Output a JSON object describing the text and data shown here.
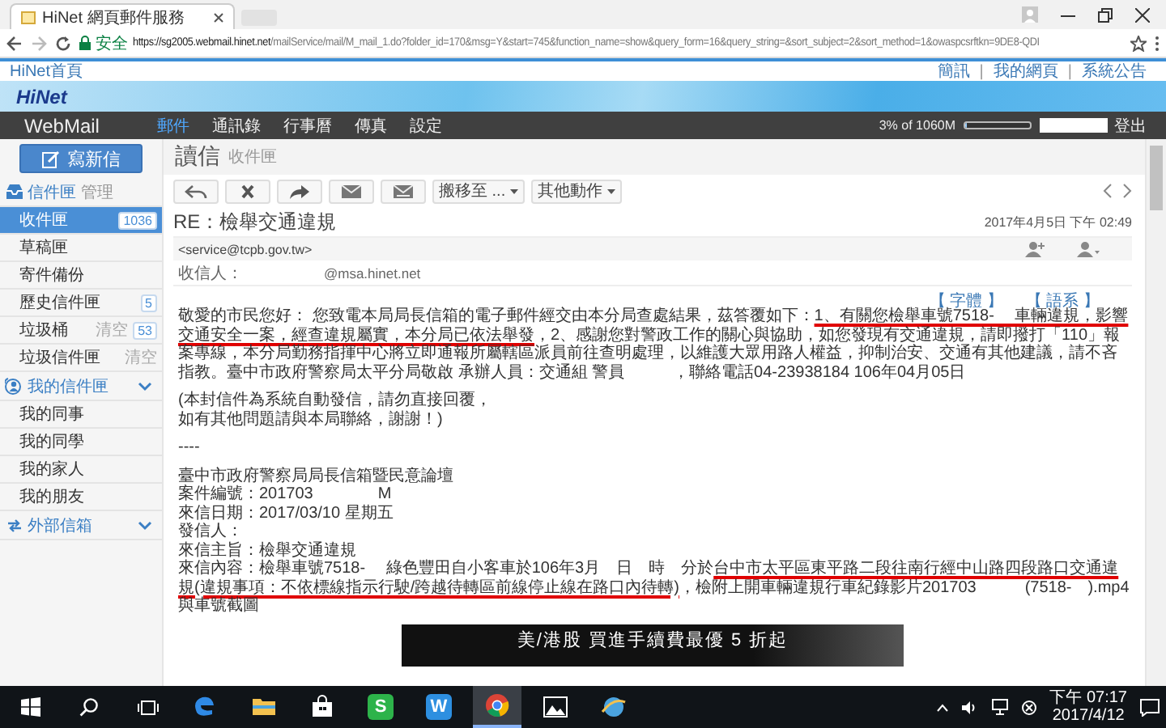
{
  "browser": {
    "tab_title": "HiNet 網頁郵件服務",
    "security_label": "安全",
    "url_host": "https://sg2005.webmail.hinet.net",
    "url_path": "/mailService/mail/M_mail_1.do?folder_id=170&msg=Y&start=745&function_name=show&query_form=16&query_string=&sort_subject=2&sort_method=1&owaspcsrftkn=9DE8-QDI"
  },
  "site_links": {
    "home": "HiNet首頁",
    "links": [
      {
        "kind": "link",
        "label": "簡訊"
      },
      {
        "kind": "separator",
        "label": "|"
      },
      {
        "kind": "link",
        "label": "我的網頁"
      },
      {
        "kind": "separator",
        "label": "|"
      },
      {
        "kind": "link",
        "label": "系統公告"
      }
    ]
  },
  "banner": {
    "logo": "HiNet"
  },
  "nav": {
    "brand": "WebMail",
    "items": [
      {
        "label": "郵件",
        "selected": true
      },
      {
        "label": "通訊錄",
        "selected": false
      },
      {
        "label": "行事曆",
        "selected": false
      },
      {
        "label": "傳真",
        "selected": false
      },
      {
        "label": "設定",
        "selected": false
      }
    ],
    "quota": {
      "text": "3% of 1060M",
      "level": 0.03
    },
    "logout": "登出"
  },
  "compose_button": "寫新信",
  "sidebar": {
    "sections": [
      {
        "title": "信件匣",
        "action": "管理",
        "collapsible": false,
        "items": [
          {
            "label": "收件匣",
            "badge": "1036",
            "selected": true
          },
          {
            "label": "草稿匣",
            "selected": false
          },
          {
            "label": "寄件備份",
            "selected": false
          },
          {
            "label": "歷史信件匣",
            "badge": "5",
            "selected": false
          },
          {
            "label": "垃圾桶",
            "action": "清空",
            "badge": "53",
            "selected": false
          },
          {
            "label": "垃圾信件匣",
            "action": "清空",
            "selected": false
          }
        ]
      },
      {
        "title": "我的信件匣",
        "collapsible": true,
        "items": [
          {
            "label": "我的同事",
            "selected": false
          },
          {
            "label": "我的同學",
            "selected": false
          },
          {
            "label": "我的家人",
            "selected": false
          },
          {
            "label": "我的朋友",
            "selected": false
          }
        ]
      },
      {
        "title": "外部信箱",
        "collapsible": true
      }
    ]
  },
  "page_header": {
    "title": "讀信",
    "subtitle": "收件匣"
  },
  "toolbar": {
    "move": "搬移至 ...",
    "more": "其他動作"
  },
  "message": {
    "subject": "RE：檢舉交通違規",
    "date": "2017年4月5日 下午 02:49",
    "from": "<service@tcpb.gov.tw>",
    "to_label": "收信人：",
    "to": "@msa.hinet.net",
    "options": [
      "【 字體 】",
      "【 語系 】"
    ],
    "body": [
      [
        {
          "text": "敬愛的市民您好： 您致電本局局長信箱的電子郵件經交由本分局查處結果，茲答覆如下：",
          "underlined": false
        },
        {
          "text": "1、有關您檢舉車號7518-　 車輛違規，影響交通安全一案，經查違規屬實，本分局已依法舉發",
          "underlined": true
        },
        {
          "text": "，2、感謝您對警政工作的關心與協助，如您發現有交通違規，請即撥打「110」報案專線，本分局勤務指揮中心將立即通報所屬轄區派員前往查明處理，以維護大眾用路人權益，抑制治安、交通有其他建議，請不吝指教。臺中市政府警察局太平分局敬啟 承辦人員：交通組 警員　　　，聯絡電話04-23938184 106年04月05日",
          "underlined": false
        }
      ],
      [
        {
          "text": "(本封信件為系統自動發信，請勿直接回覆，",
          "underlined": false
        }
      ],
      [
        {
          "text": "如有其他問題請與本局聯絡，謝謝！)",
          "underlined": false
        }
      ],
      [
        {
          "text": "----",
          "underlined": false
        }
      ],
      [
        {
          "text": "臺中市政府警察局局長信箱暨民意論壇",
          "underlined": false
        }
      ],
      [
        {
          "text": "案件編號：201703　　　　M",
          "underlined": false
        }
      ],
      [
        {
          "text": "來信日期：2017/03/10 星期五",
          "underlined": false
        }
      ],
      [
        {
          "text": "發信人：",
          "underlined": false
        }
      ],
      [
        {
          "text": "來信主旨：檢舉交通違規",
          "underlined": false
        }
      ],
      [
        {
          "text": "來信內容：檢舉車號7518-　 綠色豐田自小客車於106年3月　日　時　分於",
          "underlined": false
        },
        {
          "text": "台中市太平區東平路二段往南行經中山路四段路口交通違規(違規事項：不依標線指示行駛/跨越待轉區前線停止線在路口內待轉)",
          "underlined": true
        },
        {
          "text": "，檢附上開車輛違規行車紀錄影片201703　　　(7518-　).mp4與車號截圖",
          "underlined": false
        }
      ]
    ]
  },
  "ad": {
    "text": "美/港股 買進手續費最優 5 折起"
  },
  "taskbar": {
    "apps": [
      {
        "kind": "edge",
        "selected": false
      },
      {
        "kind": "folder",
        "selected": false
      },
      {
        "kind": "store",
        "selected": false
      },
      {
        "kind": "letter",
        "letter": "S",
        "color": "#2db34a",
        "selected": false
      },
      {
        "kind": "letter",
        "letter": "W",
        "color": "#2d8fe0",
        "selected": false
      },
      {
        "kind": "chrome",
        "selected": true
      },
      {
        "kind": "photos",
        "selected": false
      },
      {
        "kind": "globe",
        "selected": false
      }
    ],
    "time": "下午 07:17",
    "date": "2017/4/12"
  }
}
